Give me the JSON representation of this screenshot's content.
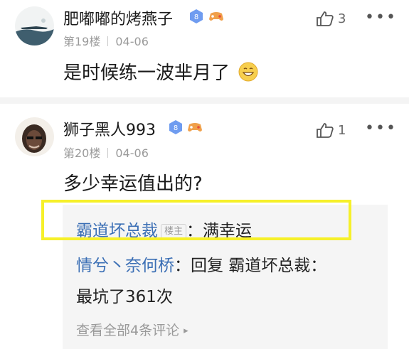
{
  "posts": [
    {
      "username": "肥嘟嘟的烤燕子",
      "floor": "第19楼",
      "date": "04-06",
      "content": "是时候练一波芈月了",
      "likes": "3",
      "level": "8",
      "emoji": "grinning-emoji"
    },
    {
      "username": "狮子黑人993",
      "floor": "第20楼",
      "date": "04-06",
      "content": "多少幸运值出的?",
      "likes": "1",
      "level": "8"
    }
  ],
  "replies": {
    "items": [
      {
        "user": "霸道坏总裁",
        "tag": "楼主",
        "colon": "：",
        "text": "满幸运"
      },
      {
        "user": "情兮丶奈何桥",
        "colon": "：",
        "text": "回复 霸道坏总裁：",
        "text2": "最坑了361次"
      }
    ],
    "view_all": "查看全部4条评论"
  },
  "more_label": "•••",
  "colors": {
    "link": "#3b6fb5",
    "highlight": "#f6f02a",
    "reply_bg": "#f5f5f5"
  }
}
